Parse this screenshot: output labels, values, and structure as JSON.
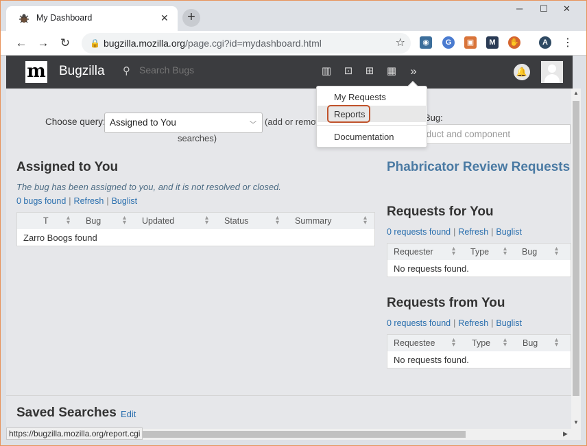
{
  "browser": {
    "tab_title": "My Dashboard",
    "tab_close": "✕",
    "new_tab": "+",
    "controls": {
      "minimize": "─",
      "maximize": "☐",
      "close": "✕"
    },
    "url_host": "bugzilla.mozilla.org",
    "url_path": "/page.cgi?id=mydashboard.html",
    "profile_initial": "A",
    "status_url": "https://bugzilla.mozilla.org/report.cgi"
  },
  "header": {
    "logo": "m",
    "brand": "Bugzilla",
    "search_placeholder": "Search Bugs"
  },
  "query": {
    "label": "Choose query:",
    "selected": "Assigned to You",
    "note_line1": "(add or remov",
    "note_line2": "searches)"
  },
  "assigned": {
    "title": "Assigned to You",
    "description": "The bug has been assigned to you, and it is not resolved or closed.",
    "count": "0 bugs found",
    "refresh": "Refresh",
    "buglist": "Buglist",
    "columns": [
      "T",
      "Bug",
      "Updated",
      "Status",
      "Summary"
    ],
    "empty": "Zarro Boogs found"
  },
  "bug_lookup": {
    "label": "Bug:",
    "placeholder": "h by product and component"
  },
  "phabricator": {
    "title": "Phabricator Review Requests"
  },
  "requests_for": {
    "title": "Requests for You",
    "count": "0 requests found",
    "refresh": "Refresh",
    "buglist": "Buglist",
    "columns": [
      "Requester",
      "Type",
      "Bug"
    ],
    "empty": "No requests found."
  },
  "requests_from": {
    "title": "Requests from You",
    "count": "0 requests found",
    "refresh": "Refresh",
    "buglist": "Buglist",
    "columns": [
      "Requestee",
      "Type",
      "Bug"
    ],
    "empty": "No requests found."
  },
  "saved": {
    "title": "Saved Searches",
    "edit": "Edit"
  },
  "menu": {
    "items": [
      "My Requests",
      "Reports",
      "Documentation"
    ],
    "highlighted": "Reports"
  },
  "colors": {
    "header_bg": "#3b3c3f",
    "link": "#2a6fae",
    "highlight": "#c0522a",
    "main_bg": "#e6e7ea"
  }
}
